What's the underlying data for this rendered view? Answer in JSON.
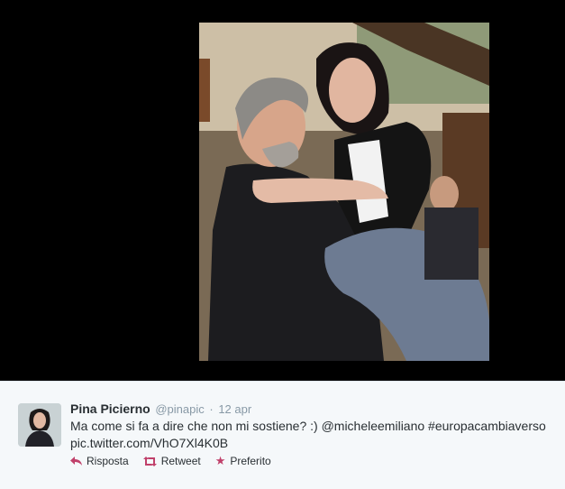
{
  "tweet": {
    "fullname": "Pina Picierno",
    "username": "@pinapic",
    "separator": "·",
    "timestamp": "12 apr",
    "text_line1": "Ma come si fa a dire che non mi sostiene? :) @micheleemiliano #europacambiaverso",
    "text_line2": "pic.twitter.com/VhO7Xl4K0B"
  },
  "actions": {
    "reply_label": "Risposta",
    "retweet_label": "Retweet",
    "favorite_label": "Preferito"
  },
  "colors": {
    "action_icon": "#c0406a",
    "name": "#292f33",
    "meta": "#8899a6",
    "media_bg": "#000000"
  },
  "icons": {
    "reply": "reply-icon",
    "retweet": "retweet-icon",
    "favorite": "star-icon"
  }
}
